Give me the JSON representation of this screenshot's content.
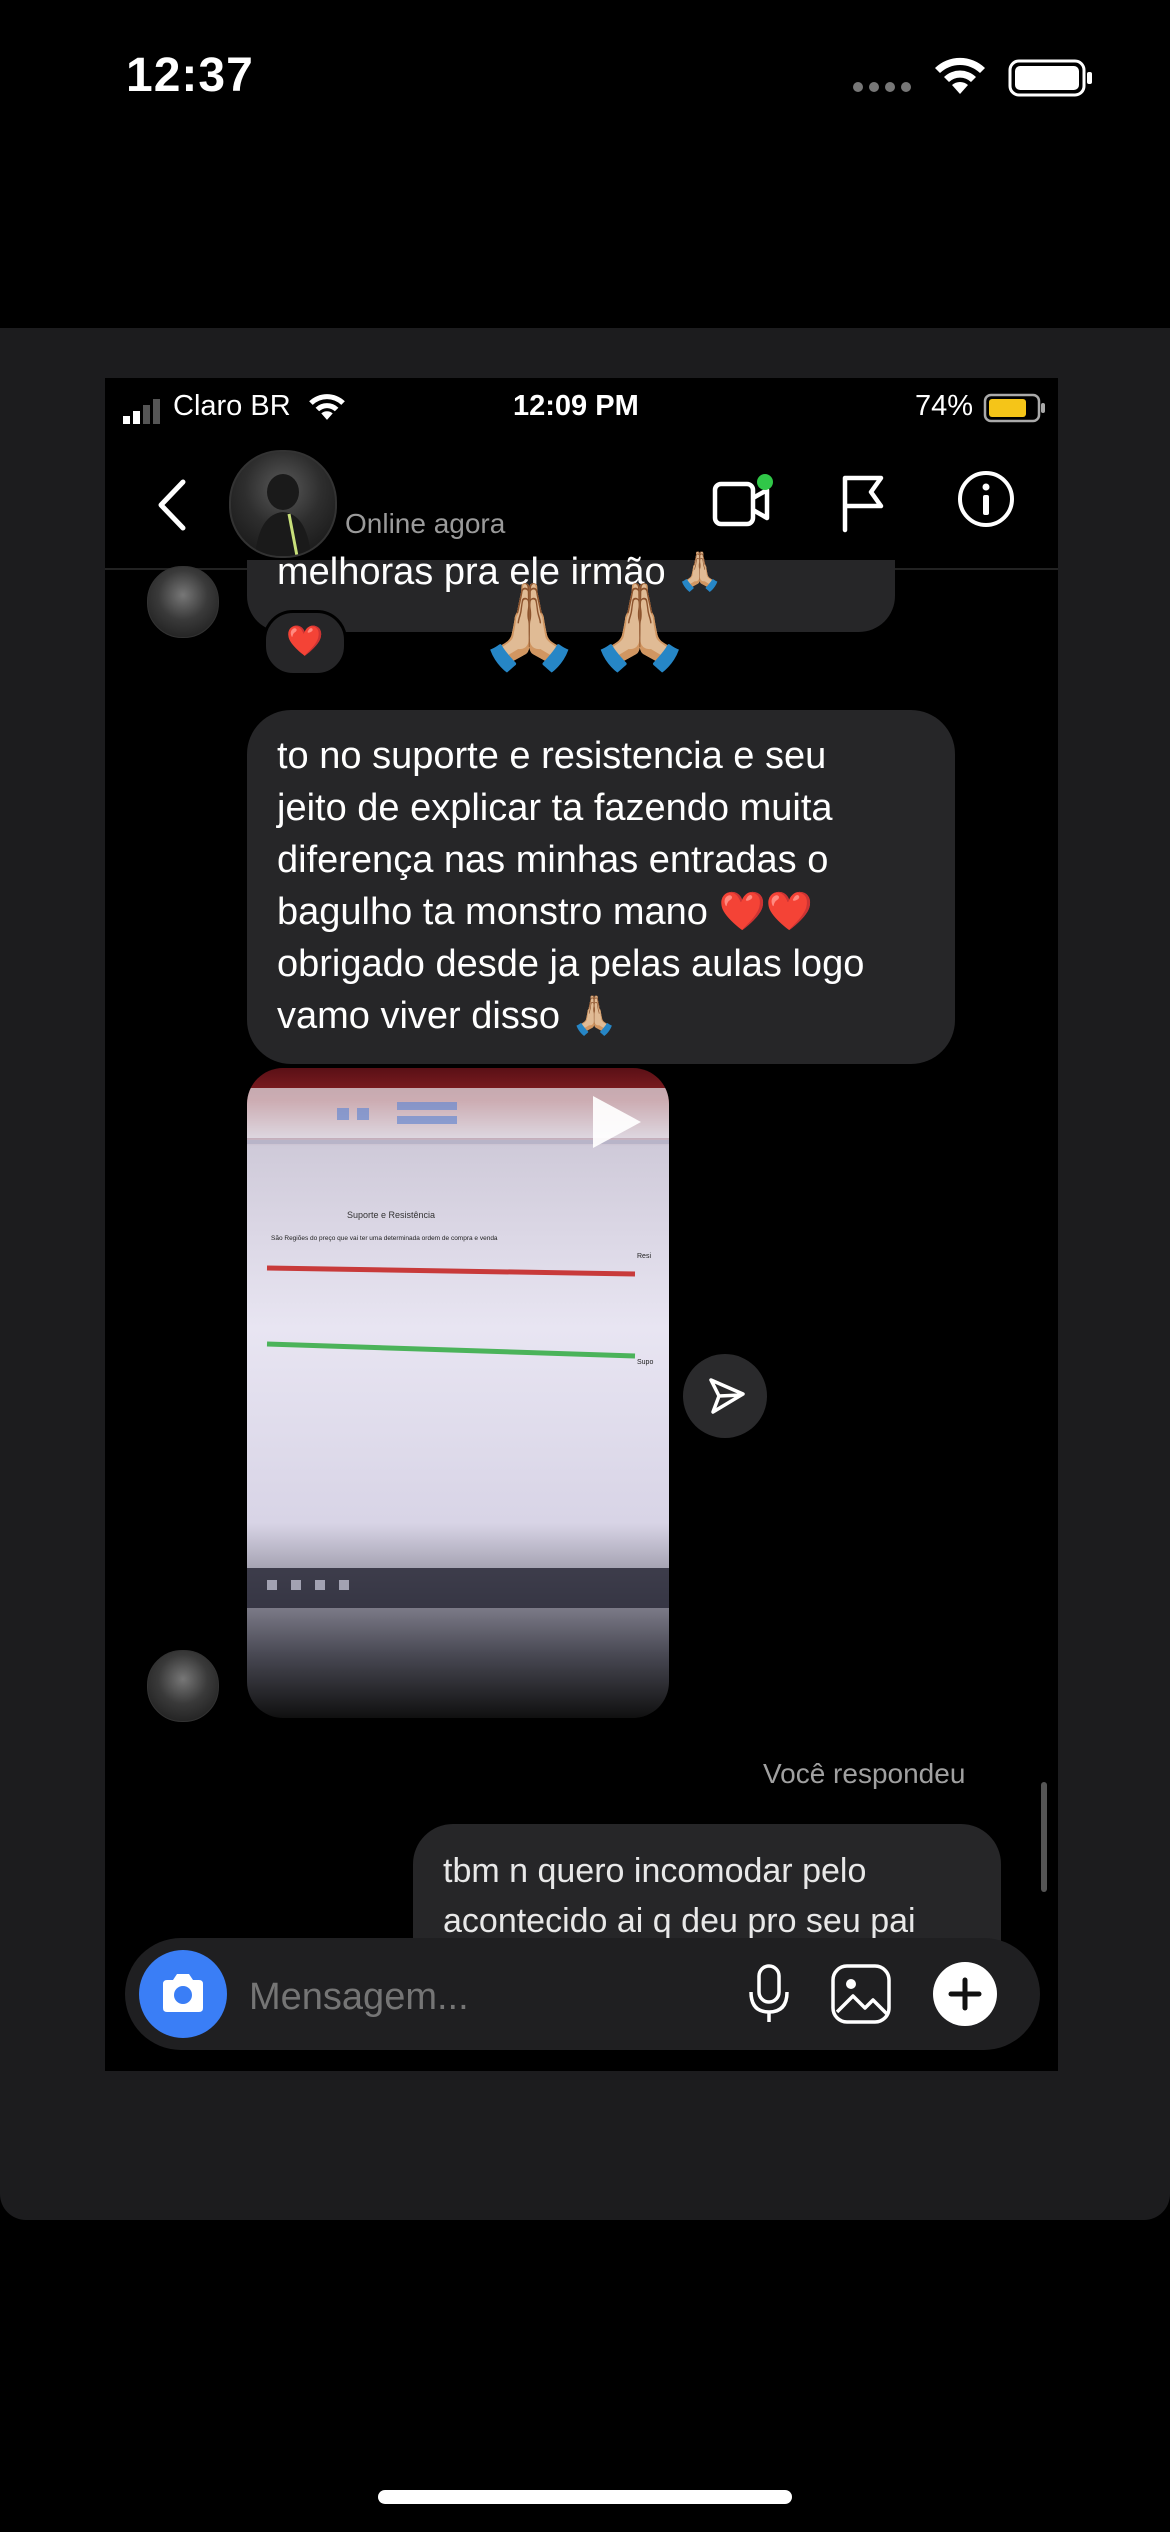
{
  "outer_status": {
    "time": "12:37"
  },
  "inner_status": {
    "carrier": "Claro BR",
    "time": "12:09 PM",
    "battery": "74%"
  },
  "header": {
    "status": "Online agora"
  },
  "messages": {
    "msg1_text": "melhoras pra ele irmão 🙏🏼",
    "reaction": "❤️",
    "hands": "🙏🏼🙏🏼",
    "msg2_text": "to no suporte e resistencia e seu\njeito de explicar ta fazendo muita\ndiferença nas minhas entradas o\nbagulho ta monstro mano ❤️❤️\nobrigado desde ja pelas aulas logo\nvamo viver disso 🙏🏼",
    "replied_label": "Você respondeu",
    "msg4_text": "tbm n quero incomodar pelo\nacontecido ai q deu pro seu pai"
  },
  "video": {
    "title": "Suporte e Resistência",
    "subtitle": "São Regiões do preço que vai ter uma determinada ordem de compra e venda",
    "label_top": "Resi",
    "label_bottom": "Supo"
  },
  "composer": {
    "placeholder": "Mensagem..."
  },
  "colors": {
    "accent_blue": "#3a7ef6",
    "online_green": "#30c748",
    "bubble": "#262628",
    "resistance_red": "#c83a3a",
    "support_green": "#4bb35a"
  },
  "icons": [
    "back-icon",
    "video-call-icon",
    "flag-icon",
    "info-icon",
    "play-icon",
    "send-icon",
    "camera-icon",
    "mic-icon",
    "gallery-icon",
    "plus-icon",
    "wifi-icon",
    "battery-icon",
    "signal-icon",
    "heart-icon"
  ]
}
